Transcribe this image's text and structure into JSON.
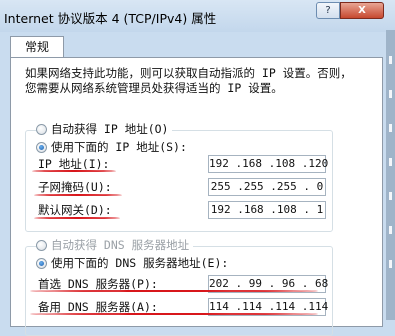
{
  "window": {
    "title": "Internet 协议版本 4 (TCP/IPv4) 属性",
    "help_button": "?",
    "close_button": "X"
  },
  "tabs": [
    {
      "label": "常规",
      "selected": true
    }
  ],
  "description": {
    "line1": "如果网络支持此功能，则可以获取自动指派的 IP 设置。否则，",
    "line2": "您需要从网络系统管理员处获得适当的 IP 设置。"
  },
  "ip_section": {
    "auto_option": {
      "label": "自动获得 IP 地址(O)",
      "selected": false
    },
    "manual_option": {
      "label": "使用下面的 IP 地址(S):",
      "selected": true
    },
    "fields": [
      {
        "label": "IP 地址(I):",
        "value": "192 .168 .108 .120"
      },
      {
        "label": "子网掩码(U):",
        "value": "255 .255 .255 . 0"
      },
      {
        "label": "默认网关(D):",
        "value": "192 .168 .108 . 1"
      }
    ]
  },
  "dns_section": {
    "auto_option": {
      "label": "自动获得 DNS 服务器地址",
      "selected": false,
      "disabled": true
    },
    "manual_option": {
      "label": "使用下面的 DNS 服务器地址(E):",
      "selected": true
    },
    "fields": [
      {
        "label": "首选 DNS 服务器(P):",
        "value": "202 . 99 . 96 . 68"
      },
      {
        "label": "备用 DNS 服务器(A):",
        "value": "114 .114 .114 .114"
      }
    ]
  },
  "annotation_color": "#d8161b"
}
